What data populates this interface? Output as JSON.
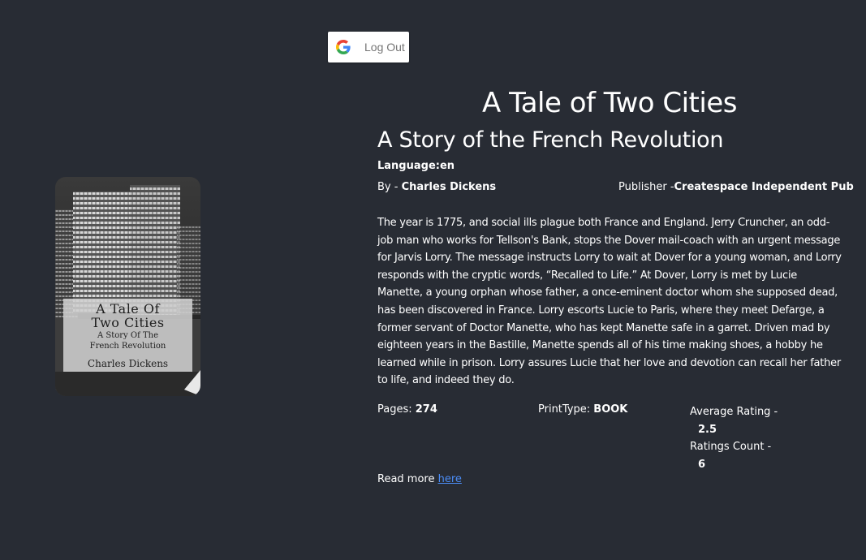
{
  "auth": {
    "logout_label": "Log Out",
    "icon": "google-g-icon"
  },
  "book": {
    "title": "A Tale of Two Cities",
    "subtitle": "A Story of the French Revolution",
    "language_label": "Language:",
    "language": "en",
    "by_label": "By - ",
    "author": "Charles Dickens",
    "publisher_label": "Publisher -",
    "publisher": "Createspace Independent Pub",
    "description": "The year is 1775, and social ills plague both France and England. Jerry Cruncher, an odd-job man who works for Tellson's Bank, stops the Dover mail-coach with an urgent message for Jarvis Lorry. The message instructs Lorry to wait at Dover for a young woman, and Lorry responds with the cryptic words, “Recalled to Life.” At Dover, Lorry is met by Lucie Manette, a young orphan whose father, a once-eminent doctor whom she supposed dead, has been discovered in France. Lorry escorts Lucie to Paris, where they meet Defarge, a former servant of Doctor Manette, who has kept Manette safe in a garret. Driven mad by eighteen years in the Bastille, Manette spends all of his time making shoes, a hobby he learned while in prison. Lorry assures Lucie that her love and devotion can recall her father to life, and indeed they do.",
    "pages_label": "Pages: ",
    "pages": "274",
    "printtype_label": "PrintType: ",
    "printtype": "BOOK",
    "avg_rating_label": "Average Rating -",
    "avg_rating": "2.5",
    "ratings_count_label": "Ratings Count -",
    "ratings_count": "6",
    "read_more_label": "Read more ",
    "read_more_link": "here"
  },
  "cover": {
    "title_line1": "A Tale Of",
    "title_line2": "Two Cities",
    "subtitle_line1": "A Story Of The",
    "subtitle_line2": "French Revolution",
    "author": "Charles Dickens"
  },
  "colors": {
    "background": "#282c34",
    "text": "#ffffff",
    "link": "#4b8cf5",
    "button_bg": "#ffffff",
    "button_text": "#757575"
  }
}
